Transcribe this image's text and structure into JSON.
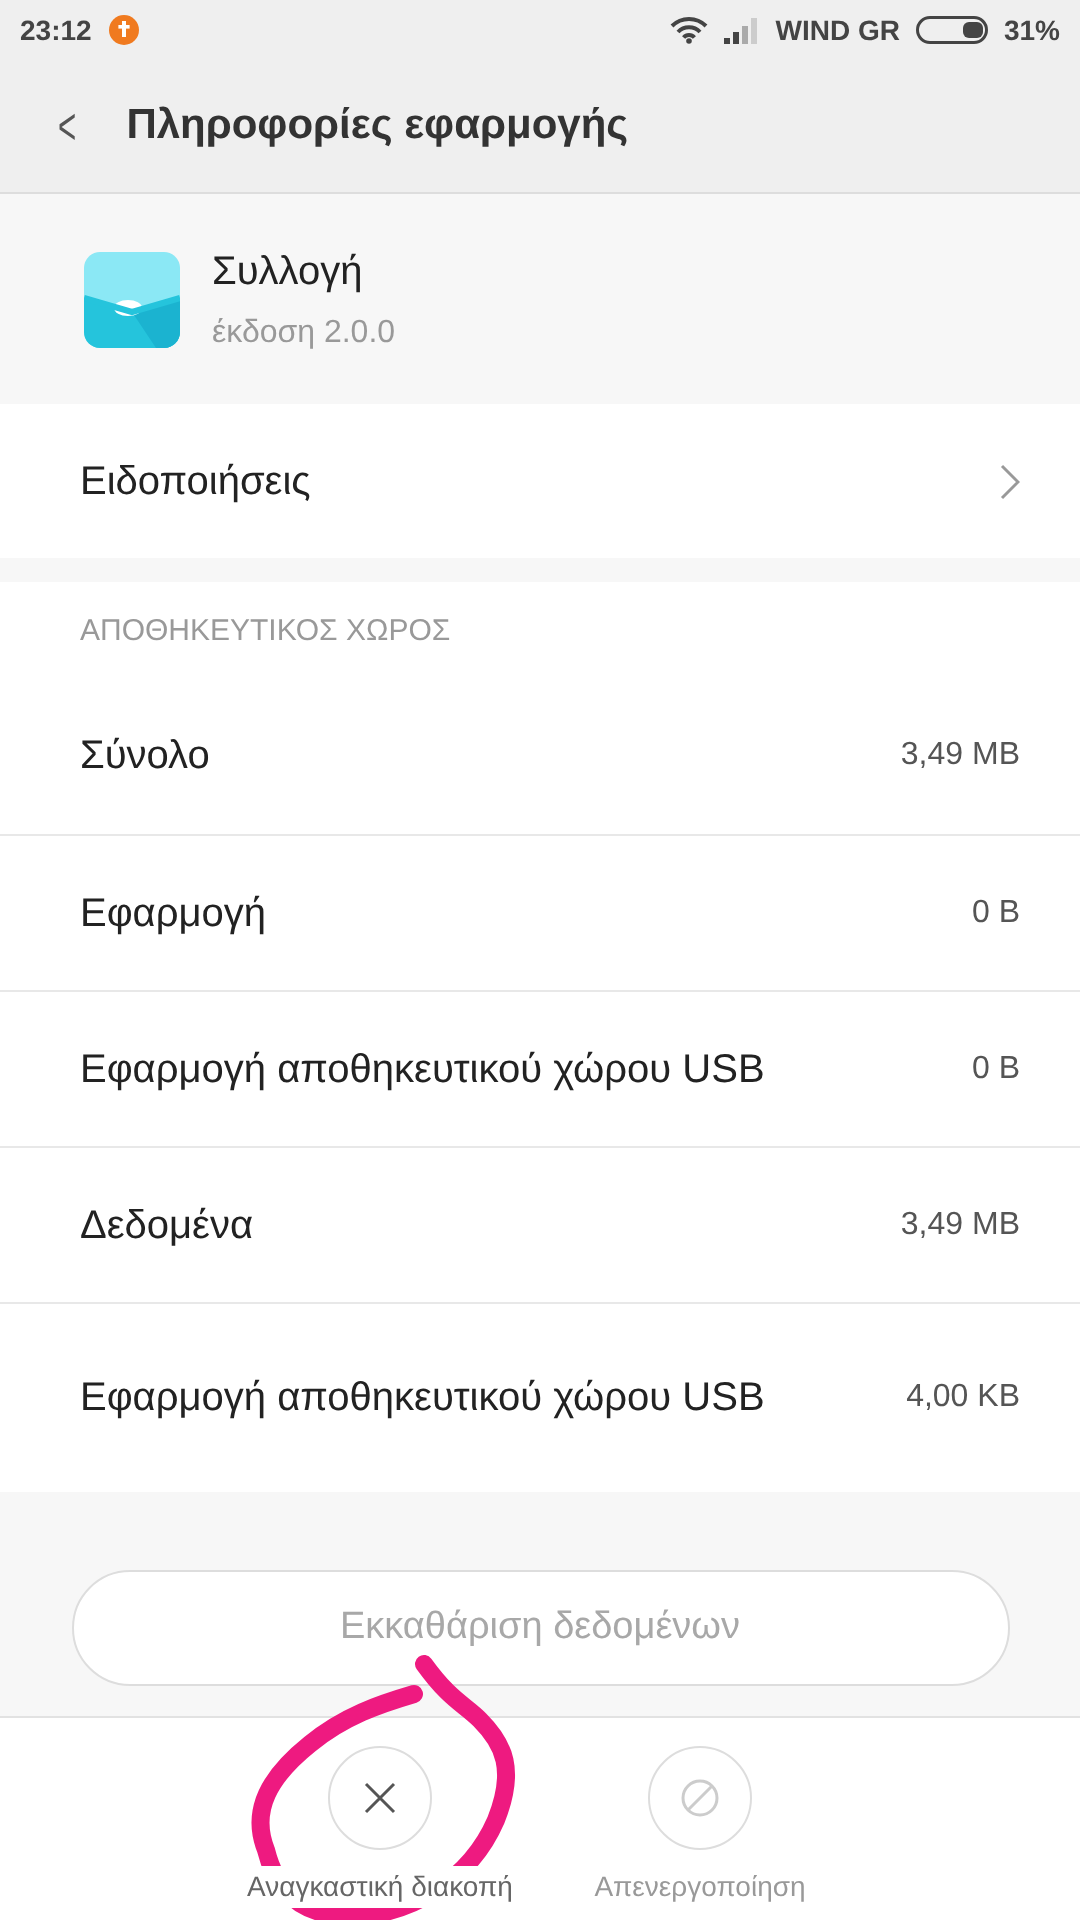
{
  "status_bar": {
    "time": "23:12",
    "carrier": "WIND GR",
    "battery_text": "31%"
  },
  "header": {
    "back_symbol": "<",
    "title": "Πληροφορίες εφαρμογής"
  },
  "app": {
    "name": "Συλλογή",
    "version": "έκδοση 2.0.0"
  },
  "notifications_row": {
    "label": "Ειδοποιήσεις"
  },
  "storage": {
    "heading": "ΑΠΟΘΗΚΕΥΤΙΚΟΣ ΧΩΡΟΣ",
    "rows": [
      {
        "label": "Σύνολο",
        "value": "3,49 MB"
      },
      {
        "label": "Εφαρμογή",
        "value": "0 B"
      },
      {
        "label": "Εφαρμογή αποθηκευτικού χώρου USB",
        "value": "0 B"
      },
      {
        "label": "Δεδομένα",
        "value": "3,49 MB"
      },
      {
        "label": "Εφαρμογή αποθηκευτικού χώρου USB",
        "value": "4,00 KB"
      }
    ]
  },
  "clear_button": {
    "label": "Εκκαθάριση δεδομένων",
    "disabled": true
  },
  "actions": [
    {
      "kind": "stop",
      "label": "Αναγκαστική διακοπή",
      "disabled": false
    },
    {
      "kind": "disable",
      "label": "Απενεργοποίηση",
      "disabled": true
    }
  ]
}
